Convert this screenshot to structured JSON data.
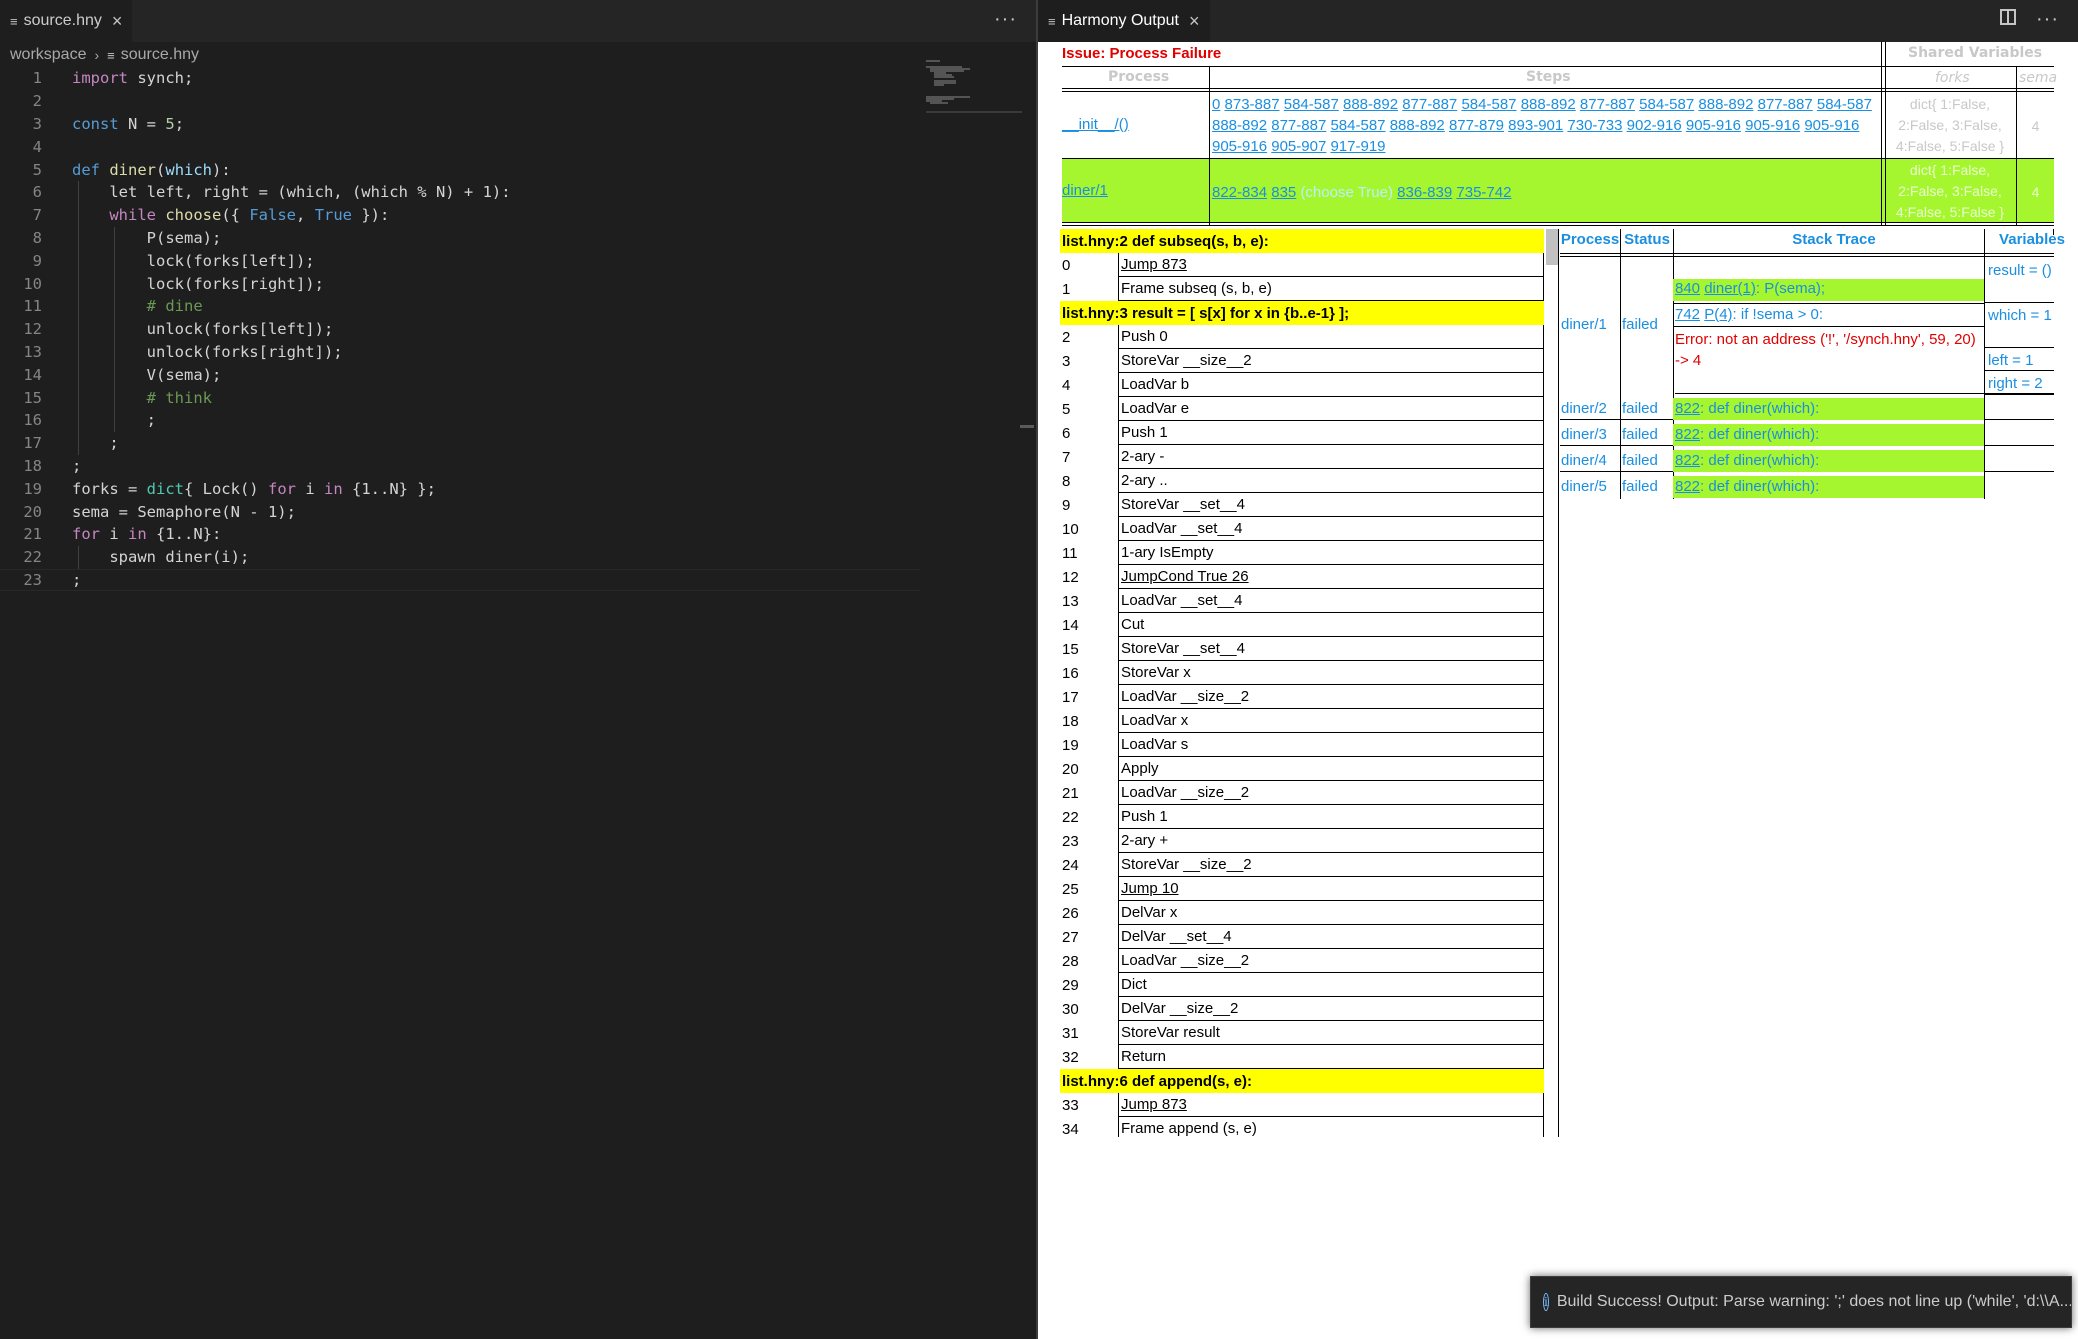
{
  "editor": {
    "tab_label": "source.hny",
    "breadcrumb": [
      "workspace",
      "source.hny"
    ],
    "more_label": "···",
    "close_label": "×",
    "file_icon": "≡",
    "lines": [
      {
        "n": "1",
        "t": [
          [
            "c",
            "import"
          ],
          [
            "p",
            " synch;"
          ]
        ]
      },
      {
        "n": "2",
        "t": []
      },
      {
        "n": "3",
        "t": [
          [
            "k",
            "const"
          ],
          [
            "p",
            " N = "
          ],
          [
            "n",
            "5"
          ],
          [
            "p",
            ";"
          ]
        ]
      },
      {
        "n": "4",
        "t": []
      },
      {
        "n": "5",
        "t": [
          [
            "k",
            "def"
          ],
          [
            "p",
            " "
          ],
          [
            "f",
            "diner"
          ],
          [
            "p",
            "("
          ],
          [
            "v",
            "which"
          ],
          [
            "p",
            "):"
          ]
        ]
      },
      {
        "n": "6",
        "t": [
          [
            "p",
            "    let left, right = (which, (which % N) + 1):"
          ]
        ]
      },
      {
        "n": "7",
        "t": [
          [
            "p",
            "    "
          ],
          [
            "c",
            "while"
          ],
          [
            "p",
            " "
          ],
          [
            "f",
            "choose"
          ],
          [
            "p",
            "({ "
          ],
          [
            "k",
            "False"
          ],
          [
            "p",
            ", "
          ],
          [
            "k",
            "True"
          ],
          [
            "p",
            " }):"
          ]
        ]
      },
      {
        "n": "8",
        "t": [
          [
            "p",
            "        P(sema);"
          ]
        ]
      },
      {
        "n": "9",
        "t": [
          [
            "p",
            "        lock(forks[left]);"
          ]
        ]
      },
      {
        "n": "10",
        "t": [
          [
            "p",
            "        lock(forks[right]);"
          ]
        ]
      },
      {
        "n": "11",
        "t": [
          [
            "cm",
            "        # dine"
          ]
        ]
      },
      {
        "n": "12",
        "t": [
          [
            "p",
            "        unlock(forks[left]);"
          ]
        ]
      },
      {
        "n": "13",
        "t": [
          [
            "p",
            "        unlock(forks[right]);"
          ]
        ]
      },
      {
        "n": "14",
        "t": [
          [
            "p",
            "        V(sema);"
          ]
        ]
      },
      {
        "n": "15",
        "t": [
          [
            "cm",
            "        # think"
          ]
        ]
      },
      {
        "n": "16",
        "t": [
          [
            "p",
            "        ;"
          ]
        ]
      },
      {
        "n": "17",
        "t": [
          [
            "p",
            "    ;"
          ]
        ]
      },
      {
        "n": "18",
        "t": [
          [
            "p",
            ";"
          ]
        ]
      },
      {
        "n": "19",
        "t": [
          [
            "p",
            "forks = "
          ],
          [
            "t",
            "dict"
          ],
          [
            "p",
            "{ Lock() "
          ],
          [
            "c",
            "for"
          ],
          [
            "p",
            " i "
          ],
          [
            "c",
            "in"
          ],
          [
            "p",
            " {1..N} };"
          ]
        ]
      },
      {
        "n": "20",
        "t": [
          [
            "p",
            "sema = Semaphore(N - 1);"
          ]
        ]
      },
      {
        "n": "21",
        "t": [
          [
            "c",
            "for"
          ],
          [
            "p",
            " i "
          ],
          [
            "c",
            "in"
          ],
          [
            "p",
            " {1..N}:"
          ]
        ]
      },
      {
        "n": "22",
        "t": [
          [
            "p",
            "    spawn diner(i);"
          ]
        ]
      },
      {
        "n": "23",
        "t": [
          [
            "p",
            ";"
          ]
        ]
      }
    ]
  },
  "output": {
    "tab_label": "Harmony Output",
    "issue": "Issue: Process Failure",
    "headers": {
      "process": "Process",
      "steps": "Steps",
      "shared": "Shared Variables",
      "forks": "forks",
      "sema": "sema"
    },
    "processes": [
      {
        "name": "__init__/()",
        "steps": [
          "0",
          "873-887",
          "584-587",
          "888-892",
          "877-887",
          "584-587",
          "888-892",
          "877-887",
          "584-587",
          "888-892",
          "877-887",
          "584-587",
          "888-892",
          "877-887",
          "584-587",
          "888-892",
          "877-879",
          "893-901",
          "730-733",
          "902-916",
          "905-916",
          "905-916",
          "905-916",
          "905-916",
          "905-907",
          "917-919"
        ],
        "forks": "dict{ 1:False, 2:False, 3:False, 4:False, 5:False }",
        "sema": "4"
      },
      {
        "name": "diner/1",
        "steps": [
          "822-834",
          "835",
          "(choose True)",
          "836-839",
          "735-742"
        ],
        "forks": "dict{ 1:False, 2:False, 3:False, 4:False, 5:False }",
        "sema": "4"
      }
    ],
    "code_sections": [
      {
        "header": "list.hny:2 def subseq(s, b, e):",
        "rows": [
          [
            "0",
            "Jump 873",
            true
          ],
          [
            "1",
            "Frame subseq (s, b, e)",
            false
          ]
        ]
      },
      {
        "header": "list.hny:3 result = [ s[x] for x in {b..e-1} ];",
        "rows": [
          [
            "2",
            "Push 0",
            false
          ],
          [
            "3",
            "StoreVar __size__2",
            false
          ],
          [
            "4",
            "LoadVar b",
            false
          ],
          [
            "5",
            "LoadVar e",
            false
          ],
          [
            "6",
            "Push 1",
            false
          ],
          [
            "7",
            "2-ary -",
            false
          ],
          [
            "8",
            "2-ary ..",
            false
          ],
          [
            "9",
            "StoreVar __set__4",
            false
          ],
          [
            "10",
            "LoadVar __set__4",
            false
          ],
          [
            "11",
            "1-ary IsEmpty",
            false
          ],
          [
            "12",
            "JumpCond True 26",
            true
          ],
          [
            "13",
            "LoadVar __set__4",
            false
          ],
          [
            "14",
            "Cut",
            false
          ],
          [
            "15",
            "StoreVar __set__4",
            false
          ],
          [
            "16",
            "StoreVar x",
            false
          ],
          [
            "17",
            "LoadVar __size__2",
            false
          ],
          [
            "18",
            "LoadVar x",
            false
          ],
          [
            "19",
            "LoadVar s",
            false
          ],
          [
            "20",
            "Apply",
            false
          ],
          [
            "21",
            "LoadVar __size__2",
            false
          ],
          [
            "22",
            "Push 1",
            false
          ],
          [
            "23",
            "2-ary +",
            false
          ],
          [
            "24",
            "StoreVar __size__2",
            false
          ],
          [
            "25",
            "Jump 10",
            true
          ],
          [
            "26",
            "DelVar x",
            false
          ],
          [
            "27",
            "DelVar __set__4",
            false
          ],
          [
            "28",
            "LoadVar __size__2",
            false
          ],
          [
            "29",
            "Dict",
            false
          ],
          [
            "30",
            "DelVar __size__2",
            false
          ],
          [
            "31",
            "StoreVar result",
            false
          ],
          [
            "32",
            "Return",
            false
          ]
        ]
      },
      {
        "header": "list.hny:6 def append(s, e):",
        "rows": [
          [
            "33",
            "Jump 873",
            true
          ],
          [
            "34",
            "Frame append (s, e)",
            false
          ]
        ]
      }
    ],
    "proc_table": {
      "headers": [
        "Process",
        "Status",
        "Stack Trace",
        "Variables"
      ],
      "rows": [
        {
          "process": "diner/1",
          "status": "failed",
          "trace": [
            {
              "pc": "840",
              "text": "diner(1): P(sema);"
            },
            {
              "pc": "742",
              "text": "P(4): if !sema > 0:"
            }
          ],
          "error": "Error: not an address ('!', '/synch.hny', 59, 20) -> 4",
          "vars": [
            "result = ()",
            "which = 1",
            "left = 1",
            "right = 2"
          ]
        },
        {
          "process": "diner/2",
          "status": "failed",
          "pc": "822",
          "text": ": def diner(which):"
        },
        {
          "process": "diner/3",
          "status": "failed",
          "pc": "822",
          "text": ": def diner(which):"
        },
        {
          "process": "diner/4",
          "status": "failed",
          "pc": "822",
          "text": ": def diner(which):"
        },
        {
          "process": "diner/5",
          "status": "failed",
          "pc": "822",
          "text": ": def diner(which):"
        }
      ]
    }
  },
  "notification": {
    "text": "Build Success! Output: Parse warning: ';' does not line up ('while', 'd:\\\\A...",
    "icon": "info-icon"
  },
  "colors": {
    "accent": "#1a8fe0",
    "highlight_green": "#a6f62f",
    "header_yellow": "#ffff00",
    "error_red": "#e00000"
  }
}
